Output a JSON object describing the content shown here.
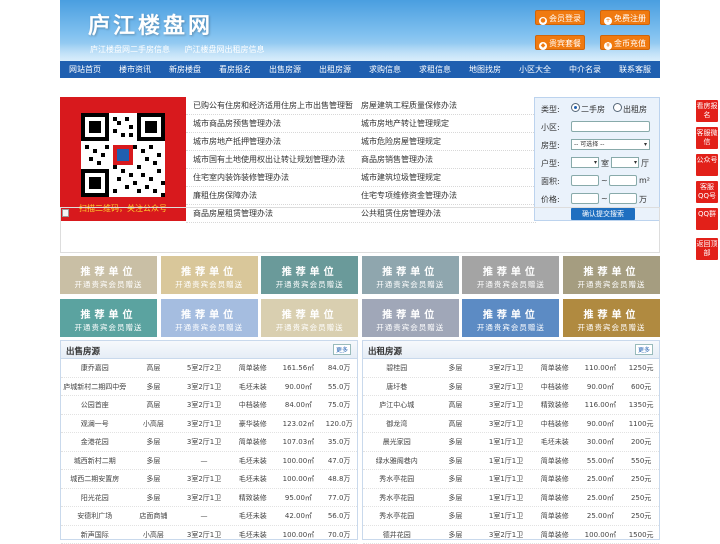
{
  "header": {
    "logo": "庐江楼盘网",
    "subtitle": [
      "庐江楼盘网二手房信息",
      "庐江楼盘网出租房信息"
    ],
    "buttons": [
      "会员登录",
      "免费注册",
      "贵宾套餐",
      "金币充值"
    ]
  },
  "nav": [
    "网站首页",
    "楼市资讯",
    "新房楼盘",
    "看房报名",
    "出售房源",
    "出租房源",
    "求购信息",
    "求租信息",
    "地图找房",
    "小区大全",
    "中介名录",
    "联系客服"
  ],
  "qr": {
    "caption": "扫描二维码，关注公众号"
  },
  "links": [
    [
      "已购公有住房和经济适用住房上市出售管理暂",
      "房屋建筑工程质量保修办法"
    ],
    [
      "城市商品房预售管理办法",
      "城市房地产转让管理规定"
    ],
    [
      "城市房地产抵押管理办法",
      "城市危险房屋管理规定"
    ],
    [
      "城市国有土地使用权出让转让规划管理办法",
      "商品房销售管理办法"
    ],
    [
      "住宅室内装饰装修管理办法",
      "城市建筑垃圾管理规定"
    ],
    [
      "廉租住房保障办法",
      "住宅专项维修资金管理办法"
    ],
    [
      "商品房屋租赁管理办法",
      "公共租赁住房管理办法"
    ]
  ],
  "search": {
    "type_label": "类型:",
    "type_options": [
      "二手房",
      "出租房"
    ],
    "community_label": "小区:",
    "housetype_label": "房型:",
    "housetype_value": "-- 可选择 --",
    "layout_label": "户型:",
    "room_unit": "室",
    "hall_unit": "厅",
    "area_label": "面积:",
    "area_unit": "m²",
    "price_label": "价格:",
    "price_unit": "万",
    "range_sep": "~",
    "submit": "确认提交搜索"
  },
  "ads": {
    "line1": "推荐单位",
    "line2": "开通贵宾会员赠送"
  },
  "sale": {
    "title": "出售房源",
    "more": "更多",
    "rows": [
      [
        "康乔嘉园",
        "高层",
        "5室2厅2卫",
        "简单装修",
        "161.56㎡",
        "84.0万"
      ],
      [
        "庐城新村二期四中旁",
        "多层",
        "3室2厅1卫",
        "毛坯未装",
        "90.00㎡",
        "55.0万"
      ],
      [
        "公园首座",
        "高层",
        "3室2厅1卫",
        "中档装修",
        "84.00㎡",
        "75.0万"
      ],
      [
        "观澜一号",
        "小高层",
        "3室2厅1卫",
        "豪华装修",
        "123.02㎡",
        "120.0万"
      ],
      [
        "金港花园",
        "多层",
        "3室2厅1卫",
        "简单装修",
        "107.03㎡",
        "35.0万"
      ],
      [
        "城西新村二期",
        "多层",
        "—",
        "毛坯未装",
        "100.00㎡",
        "47.0万"
      ],
      [
        "城西二期安置房",
        "多层",
        "3室2厅1卫",
        "毛坯未装",
        "100.00㎡",
        "48.8万"
      ],
      [
        "阳光花园",
        "多层",
        "3室2厅1卫",
        "精致装修",
        "95.00㎡",
        "77.0万"
      ],
      [
        "安德利广场",
        "店面商铺",
        "—",
        "毛坯未装",
        "42.00㎡",
        "56.0万"
      ],
      [
        "新声国际",
        "小高层",
        "3室2厅1卫",
        "毛坯未装",
        "100.00㎡",
        "70.0万"
      ]
    ]
  },
  "rent": {
    "title": "出租房源",
    "more": "更多",
    "rows": [
      [
        "碧桂园",
        "多层",
        "3室2厅1卫",
        "简单装修",
        "110.00㎡",
        "1250元"
      ],
      [
        "唐圩巷",
        "多层",
        "3室2厅1卫",
        "中档装修",
        "90.00㎡",
        "600元"
      ],
      [
        "庐江中心城",
        "高层",
        "3室2厅1卫",
        "精致装修",
        "116.00㎡",
        "1350元"
      ],
      [
        "御龙湾",
        "高层",
        "3室2厅1卫",
        "中档装修",
        "90.00㎡",
        "1100元"
      ],
      [
        "晨光家园",
        "多层",
        "1室1厅1卫",
        "毛坯未装",
        "30.00㎡",
        "200元"
      ],
      [
        "绿水雅阁巷内",
        "多层",
        "1室1厅1卫",
        "简单装修",
        "55.00㎡",
        "550元"
      ],
      [
        "秀水亭花园",
        "多层",
        "1室1厅1卫",
        "简单装修",
        "25.00㎡",
        "250元"
      ],
      [
        "秀水亭花园",
        "多层",
        "1室1厅1卫",
        "简单装修",
        "25.00㎡",
        "250元"
      ],
      [
        "秀水亭花园",
        "多层",
        "1室1厅1卫",
        "简单装修",
        "25.00㎡",
        "250元"
      ],
      [
        "德井花园",
        "多层",
        "3室2厅1卫",
        "简单装修",
        "100.00㎡",
        "1500元"
      ]
    ]
  },
  "side": [
    "看房报名",
    "客服微信",
    "公众号",
    "客服QQ号",
    "QQ群",
    "返回顶部"
  ],
  "colors": {
    "nav": "#1f5fb0",
    "accent": "#f07a10",
    "qr_bg": "#d8191d"
  }
}
